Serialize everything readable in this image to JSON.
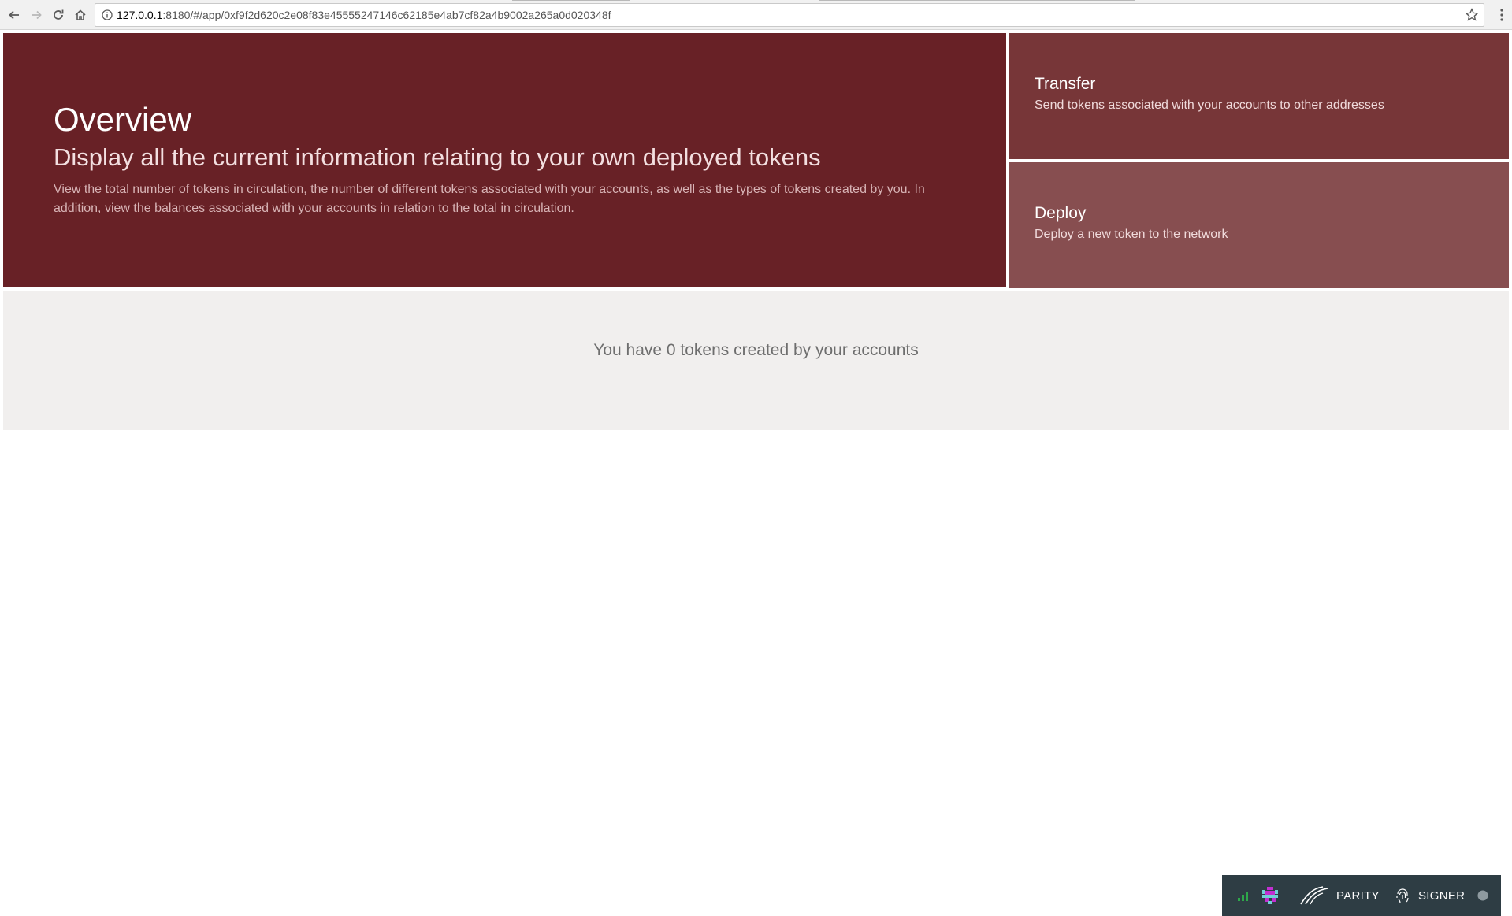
{
  "browser": {
    "url_host": "127.0.0.1",
    "url_rest": ":8180/#/app/0xf9f2d620c2e08f83e45555247146c62185e4ab7cf82a4b9002a265a0d020348f"
  },
  "overview": {
    "title": "Overview",
    "subtitle": "Display all the current information relating to your own deployed tokens",
    "description": "View the total number of tokens in circulation, the number of different tokens associated with your accounts, as well as the types of tokens created by you. In addition, view the balances associated with your accounts in relation to the total in circulation."
  },
  "actions": {
    "transfer": {
      "title": "Transfer",
      "description": "Send tokens associated with your accounts to other addresses"
    },
    "deploy": {
      "title": "Deploy",
      "description": "Deploy a new token to the network"
    }
  },
  "summary": {
    "text": "You have 0 tokens created by your accounts"
  },
  "status_bar": {
    "parity_label": "PARITY",
    "signer_label": "SIGNER"
  },
  "colors": {
    "hero_bg": "#682126",
    "transfer_bg": "#773638",
    "deploy_bg": "#874e50",
    "summary_bg": "#f1efee",
    "status_bar_bg": "#2e3d44"
  },
  "icons": [
    "back-arrow-icon",
    "forward-arrow-icon",
    "reload-icon",
    "home-icon",
    "info-icon",
    "star-icon",
    "more-vert-icon",
    "signal-icon",
    "identicon-icon",
    "parity-logo-icon",
    "fingerprint-icon",
    "status-dot-icon"
  ]
}
